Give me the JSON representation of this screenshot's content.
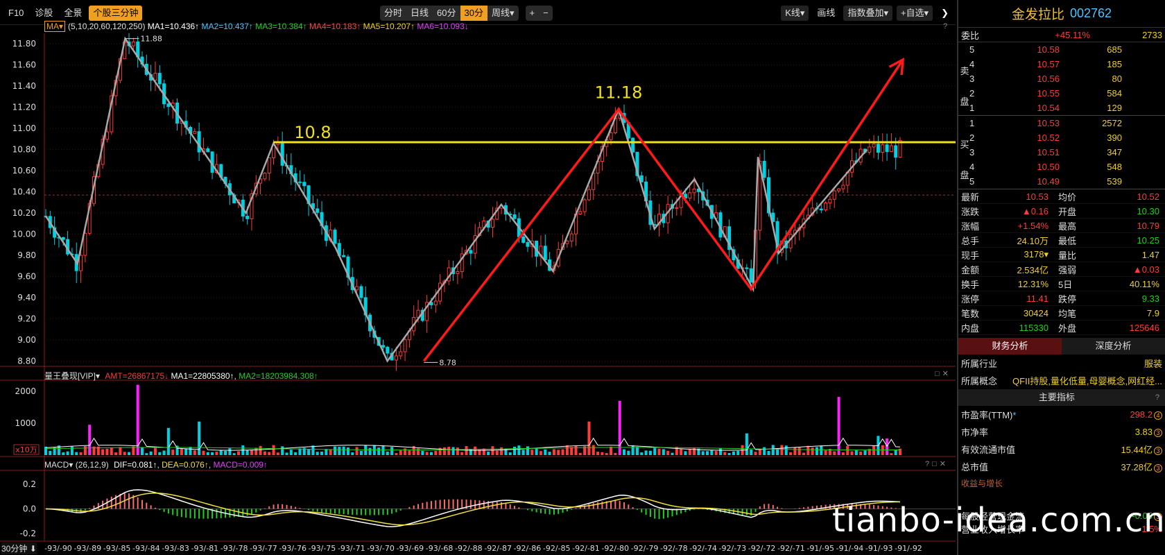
{
  "toolbar": {
    "left": [
      "F10",
      "诊股",
      "全景",
      "个股三分钟"
    ],
    "periods": [
      "分时",
      "日线",
      "60分",
      "30分",
      "周线▾"
    ],
    "zoom": [
      "+",
      "−"
    ],
    "right": [
      "K线▾",
      "画线",
      "指数叠加▾",
      "+自选▾"
    ],
    "close": "❯"
  },
  "ma_header": {
    "badge": "MA▾",
    "params": "(5,10,20,60,120,250)",
    "items": [
      {
        "text": "MA1=10.436↑",
        "color": "#ffffff"
      },
      {
        "text": "MA2=10.437↑",
        "color": "#4fc3ff"
      },
      {
        "text": "MA3=10.384↑",
        "color": "#20d020"
      },
      {
        "text": "MA4=10.183↑",
        "color": "#ff4040"
      },
      {
        "text": "MA5=10.207↑",
        "color": "#f0d020"
      },
      {
        "text": "MA6=10.093↓",
        "color": "#e040fb"
      }
    ]
  },
  "chart_data": [
    {
      "type": "candlestick",
      "title": "",
      "ylim": [
        8.75,
        11.9
      ],
      "ytick_labels": [
        "11.80",
        "11.60",
        "11.40",
        "11.20",
        "11.00",
        "10.80",
        "10.60",
        "10.40",
        "10.20",
        "10.00",
        "9.80",
        "9.60",
        "9.40",
        "9.20",
        "9.00",
        "8.80"
      ],
      "high_label": "11.88",
      "low_label": "8.78",
      "annotations": [
        "10.8",
        "11.18"
      ],
      "resistance_level": 10.87,
      "ref_price": 10.37,
      "zigzag_gray": [
        [
          0,
          10.17
        ],
        [
          46,
          9.72
        ],
        [
          115,
          11.85
        ],
        [
          290,
          10.2
        ],
        [
          330,
          10.86
        ],
        [
          420,
          9.87
        ],
        [
          495,
          8.8
        ],
        [
          660,
          10.28
        ],
        [
          735,
          9.65
        ],
        [
          830,
          11.18
        ],
        [
          882,
          10.05
        ],
        [
          940,
          10.52
        ],
        [
          1025,
          9.48
        ],
        [
          1032,
          10.73
        ],
        [
          1062,
          9.82
        ],
        [
          1190,
          10.8
        ]
      ],
      "zigzag_red": [
        [
          548,
          8.8
        ],
        [
          830,
          11.18
        ],
        [
          1022,
          9.48
        ],
        [
          1242,
          11.65
        ]
      ],
      "xlabels": [
        "-93/-90",
        "-93/-89",
        "-93/-85",
        "-93/-84",
        "-93/-83",
        "-93/-81",
        "-93/-78",
        "-93/-77",
        "-93/-76",
        "-93/-75",
        "-93/-71",
        "-93/-70",
        "-93/-69",
        "-93/-68",
        "-92/-88",
        "-92/-87",
        "-92/-86",
        "-92/-85",
        "-92/-81",
        "-92/-80",
        "-92/-79",
        "-92/-78",
        "-92/-74",
        "-92/-73",
        "-92/-72",
        "-92/-71",
        "-91/-95",
        "-91/-94",
        "-91/-93",
        "-91/-92"
      ]
    },
    {
      "type": "bar",
      "title": "量王叠现[VIP]▾",
      "series": [
        {
          "name": "AMT=26867175↓",
          "color": "#ff3b3b"
        },
        {
          "name": "MA1=22805380↑",
          "color": "#ffffff"
        },
        {
          "name": "MA2=18203984.308↑",
          "color": "#20d020"
        }
      ],
      "ytick_labels": [
        "2000",
        "1000"
      ],
      "unit_label": "x10万",
      "ylim": [
        0,
        2300
      ]
    },
    {
      "type": "line",
      "title": "MACD▾",
      "params": "(26,12,9)",
      "series": [
        {
          "name": "DIF=0.081↑",
          "color": "#ffffff"
        },
        {
          "name": "DEA=0.076↑",
          "color": "#f0e040"
        },
        {
          "name": "MACD=0.009↑",
          "color": "#e040fb"
        }
      ],
      "ytick_labels": [
        "0.2",
        "0.0",
        "-0.2"
      ],
      "ylim": [
        -0.25,
        0.3
      ]
    }
  ],
  "period_label": "30分钟",
  "stock": {
    "name": "金发拉比",
    "code": "002762"
  },
  "weibi": {
    "label": "委比",
    "pct": "+45.11%",
    "val": "2733"
  },
  "sell_side": "卖盘",
  "buy_side": "买盘",
  "asks": [
    {
      "lv": "5",
      "px": "10.58",
      "vol": "685"
    },
    {
      "lv": "4",
      "px": "10.57",
      "vol": "185"
    },
    {
      "lv": "3",
      "px": "10.56",
      "vol": "80"
    },
    {
      "lv": "2",
      "px": "10.55",
      "vol": "584"
    },
    {
      "lv": "1",
      "px": "10.54",
      "vol": "129"
    }
  ],
  "bids": [
    {
      "lv": "1",
      "px": "10.53",
      "vol": "2572"
    },
    {
      "lv": "2",
      "px": "10.52",
      "vol": "390"
    },
    {
      "lv": "3",
      "px": "10.51",
      "vol": "347"
    },
    {
      "lv": "4",
      "px": "10.50",
      "vol": "548"
    },
    {
      "lv": "5",
      "px": "10.49",
      "vol": "539"
    }
  ],
  "quote": [
    {
      "l1": "最新",
      "v1": "10.53",
      "c1": "red",
      "l2": "均价",
      "v2": "10.52",
      "c2": "red"
    },
    {
      "l1": "涨跌",
      "v1": "▲0.16",
      "c1": "red",
      "l2": "开盘",
      "v2": "10.30",
      "c2": "green"
    },
    {
      "l1": "涨幅",
      "v1": "+1.54%",
      "c1": "red",
      "l2": "最高",
      "v2": "10.79",
      "c2": "red"
    },
    {
      "l1": "总手",
      "v1": "24.10万",
      "c1": "yellow",
      "l2": "最低",
      "v2": "10.25",
      "c2": "green"
    },
    {
      "l1": "现手",
      "v1": "3178▾",
      "c1": "yellow",
      "l2": "量比",
      "v2": "1.47",
      "c2": "yellow"
    },
    {
      "l1": "金额",
      "v1": "2.534亿",
      "c1": "yellow",
      "l2": "强弱",
      "v2": "▲0.03",
      "c2": "red"
    },
    {
      "l1": "换手",
      "v1": "12.31%",
      "c1": "yellow",
      "l2": "5日",
      "v2": "40.11%",
      "c2": "yellow"
    },
    {
      "l1": "涨停",
      "v1": "11.41",
      "c1": "red",
      "l2": "跌停",
      "v2": "9.33",
      "c2": "green"
    },
    {
      "l1": "笔数",
      "v1": "30424",
      "c1": "yellow",
      "l2": "均笔",
      "v2": "7.9",
      "c2": "yellow"
    },
    {
      "l1": "内盘",
      "v1": "115330",
      "c1": "green",
      "l2": "外盘",
      "v2": "125646",
      "c2": "red"
    }
  ],
  "tabs": [
    "财务分析",
    "深度分析"
  ],
  "industry": {
    "label": "所属行业",
    "value": "服装"
  },
  "concept": {
    "label": "所属概念",
    "value": "QFII持股,量化低量,母婴概念,网红经..."
  },
  "indicators_head": "主要指标",
  "indicators": [
    {
      "label": "市盈率(TTM)*",
      "value": "298.2",
      "badge": "4"
    },
    {
      "label": "市净率",
      "value": "3.83",
      "badge": "3"
    },
    {
      "label": "有效流通市值",
      "value": "15.44亿",
      "badge": "3"
    },
    {
      "label": "总市值",
      "value": "37.28亿",
      "badge": "3"
    }
  ],
  "growth_head": "收益与增长",
  "cash_row": {
    "label": "每股经营现金流",
    "value": "-0.05",
    "badge": "3"
  },
  "rev_row": {
    "label": "营业收入增长率",
    "value": "1.5%"
  },
  "watermark": "tianbo-idea.com.cn"
}
